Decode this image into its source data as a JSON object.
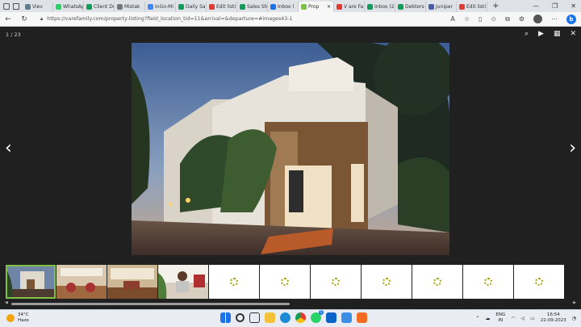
{
  "browser": {
    "tabs": [
      {
        "label": "Viev",
        "color": "#607d8b"
      },
      {
        "label": "WhatsAp",
        "color": "#25d366"
      },
      {
        "label": "Client De",
        "color": "#0f9d58"
      },
      {
        "label": "Mistak",
        "color": "#777777"
      },
      {
        "label": "InGo-Mi",
        "color": "#4285f4"
      },
      {
        "label": "Daily Sa",
        "color": "#0f9d58"
      },
      {
        "label": "Edit listi",
        "color": "#e53935"
      },
      {
        "label": "Sales Sh",
        "color": "#0f9d58"
      },
      {
        "label": "Inbox (",
        "color": "#1a73e8"
      },
      {
        "label": "Prop",
        "color": "#7dc242",
        "active": true
      },
      {
        "label": "V are Fa",
        "color": "#e53935"
      },
      {
        "label": "Inbox (2",
        "color": "#0f9d58"
      },
      {
        "label": "Debtors",
        "color": "#0f9d58"
      },
      {
        "label": "Juniper",
        "color": "#4a5ea8"
      },
      {
        "label": "Edit listi",
        "color": "#e53935"
      }
    ],
    "url": "https://varefamily.com/property-listing?field_location_tid=11&arrival=&departure=#images43-1"
  },
  "viewer": {
    "counter": "1 / 23",
    "thumbnails_total": 11,
    "loaded_thumbnails": 4
  },
  "taskbar": {
    "temperature": "34°C",
    "weather": "Haze",
    "lang_top": "ENG",
    "lang_bottom": "IN",
    "time": "16:54",
    "date": "22-09-2023",
    "whatsapp_badge": "5"
  }
}
